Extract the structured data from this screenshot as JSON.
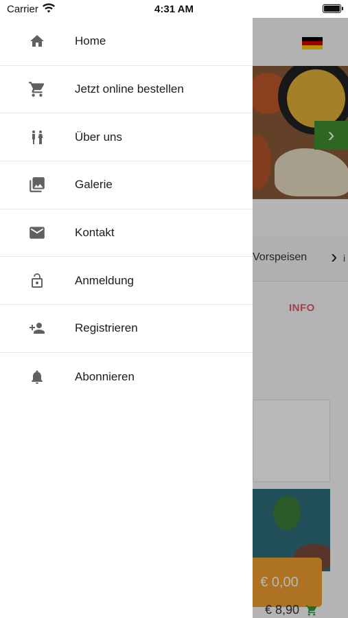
{
  "status_bar": {
    "carrier": "Carrier",
    "time": "4:31 AM"
  },
  "menu": {
    "items": [
      {
        "label": "Home",
        "icon": "home-icon"
      },
      {
        "label": "Jetzt online bestellen",
        "icon": "cart-icon"
      },
      {
        "label": "Über uns",
        "icon": "people-icon"
      },
      {
        "label": "Galerie",
        "icon": "gallery-icon"
      },
      {
        "label": "Kontakt",
        "icon": "mail-icon"
      },
      {
        "label": "Anmeldung",
        "icon": "lock-icon"
      },
      {
        "label": "Registrieren",
        "icon": "add-user-icon"
      },
      {
        "label": "Abonnieren",
        "icon": "bell-icon"
      }
    ]
  },
  "background": {
    "category_label": "Vorspeisen",
    "category_more": "i",
    "info_tab": "INFO",
    "cart_total": "€ 0,00",
    "item_price": "€ 8,90"
  },
  "colors": {
    "icon": "#616161",
    "accent_green": "#3f8f2e",
    "info_pink": "#e05a6a",
    "cart_orange": "#f0a030"
  }
}
